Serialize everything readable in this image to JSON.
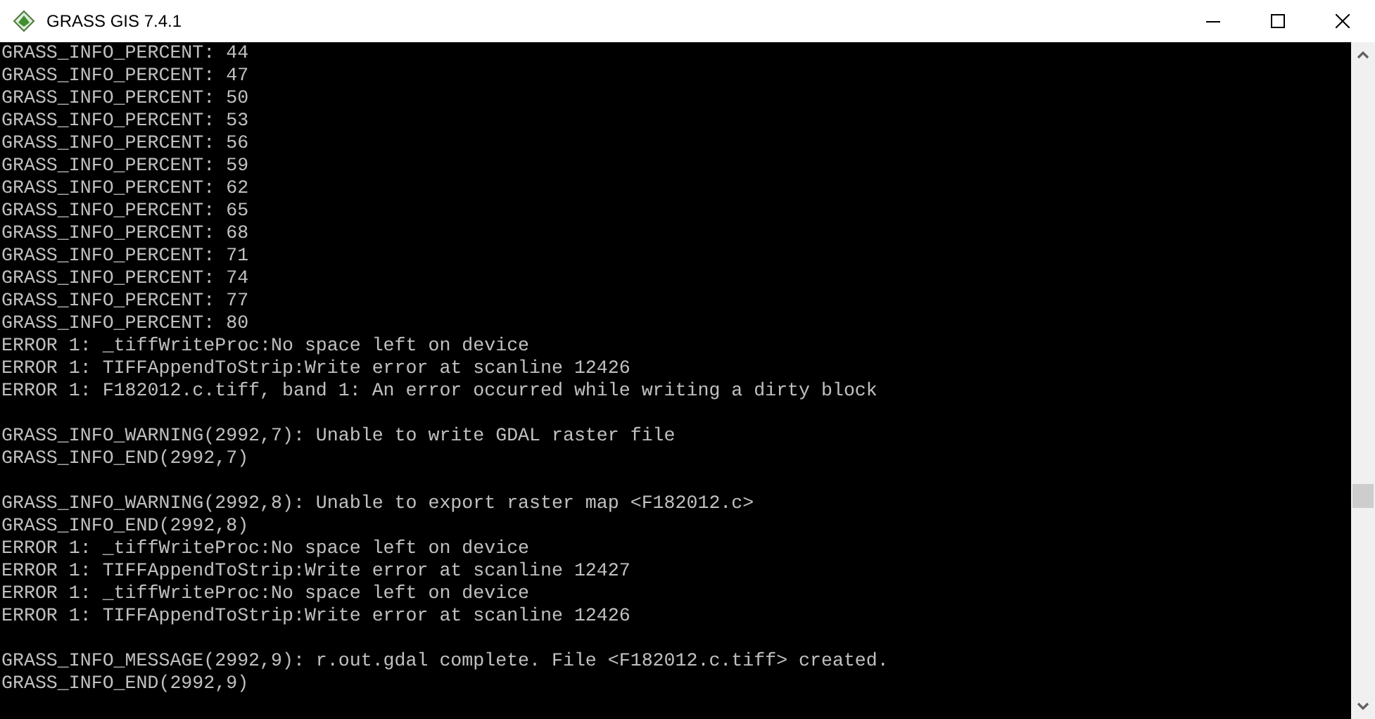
{
  "window": {
    "title": "GRASS GIS 7.4.1"
  },
  "console": {
    "blocks": [
      [
        "GRASS_INFO_PERCENT: 44",
        "GRASS_INFO_PERCENT: 47",
        "GRASS_INFO_PERCENT: 50",
        "GRASS_INFO_PERCENT: 53",
        "GRASS_INFO_PERCENT: 56",
        "GRASS_INFO_PERCENT: 59",
        "GRASS_INFO_PERCENT: 62",
        "GRASS_INFO_PERCENT: 65",
        "GRASS_INFO_PERCENT: 68",
        "GRASS_INFO_PERCENT: 71",
        "GRASS_INFO_PERCENT: 74",
        "GRASS_INFO_PERCENT: 77",
        "GRASS_INFO_PERCENT: 80",
        "ERROR 1: _tiffWriteProc:No space left on device",
        "ERROR 1: TIFFAppendToStrip:Write error at scanline 12426",
        "ERROR 1: F182012.c.tiff, band 1: An error occurred while writing a dirty block"
      ],
      [
        "GRASS_INFO_WARNING(2992,7): Unable to write GDAL raster file",
        "GRASS_INFO_END(2992,7)"
      ],
      [
        "GRASS_INFO_WARNING(2992,8): Unable to export raster map <F182012.c>",
        "GRASS_INFO_END(2992,8)",
        "ERROR 1: _tiffWriteProc:No space left on device",
        "ERROR 1: TIFFAppendToStrip:Write error at scanline 12427",
        "ERROR 1: _tiffWriteProc:No space left on device",
        "ERROR 1: TIFFAppendToStrip:Write error at scanline 12426"
      ],
      [
        "GRASS_INFO_MESSAGE(2992,9): r.out.gdal complete. File <F182012.c.tiff> created.",
        "GRASS_INFO_END(2992,9)"
      ]
    ]
  }
}
